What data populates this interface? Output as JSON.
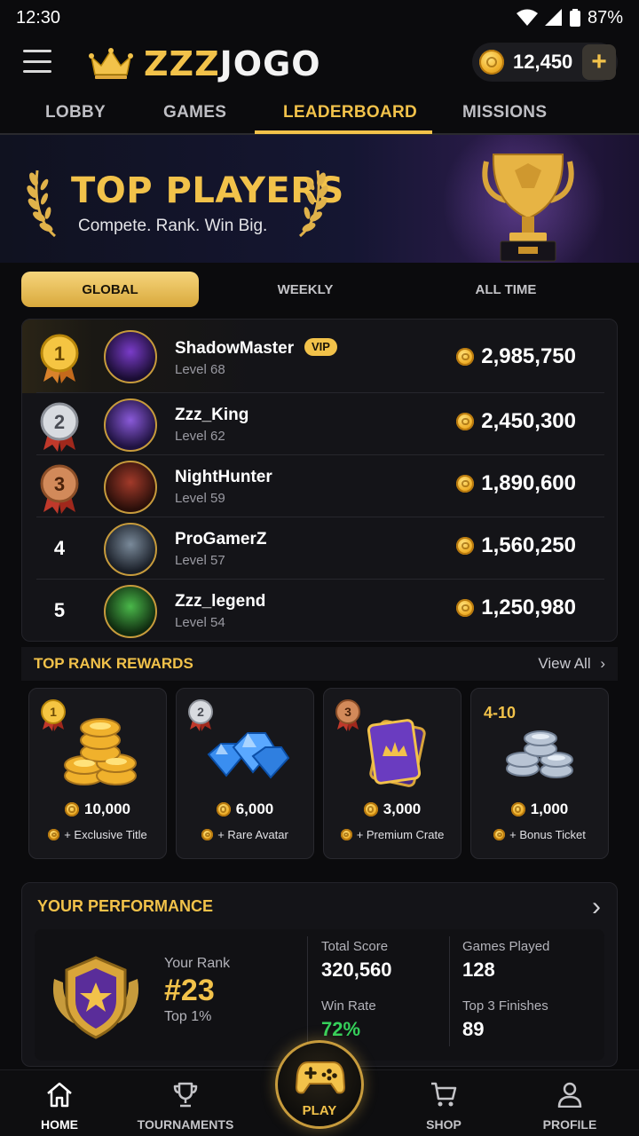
{
  "status_bar": {
    "time": "12:30",
    "battery": "87%"
  },
  "header": {
    "brand_first": "ZZZ",
    "brand_second": "JOGO",
    "coins": "12,450",
    "add_label": "+"
  },
  "tabs": [
    {
      "label": "LOBBY"
    },
    {
      "label": "GAMES"
    },
    {
      "label": "LEADERBOARD",
      "active": true
    },
    {
      "label": "MISSIONS"
    }
  ],
  "hero": {
    "title": "TOP PLAYERS",
    "subtitle": "Compete. Rank. Win Big."
  },
  "filters": [
    {
      "label": "GLOBAL",
      "active": true
    },
    {
      "label": "WEEKLY"
    },
    {
      "label": "ALL TIME"
    }
  ],
  "leaderboard": [
    {
      "rank": "1",
      "name": "ShadowMaster",
      "badge": "VIP",
      "level": "Level 68",
      "score": "2,985,750"
    },
    {
      "rank": "2",
      "name": "Zzz_King",
      "level": "Level 62",
      "score": "2,450,300"
    },
    {
      "rank": "3",
      "name": "NightHunter",
      "level": "Level 59",
      "score": "1,890,600"
    },
    {
      "rank": "4",
      "name": "ProGamerZ",
      "level": "Level 57",
      "score": "1,560,250"
    },
    {
      "rank": "5",
      "name": "Zzz_legend",
      "level": "Level 54",
      "score": "1,250,980"
    }
  ],
  "rewards": {
    "title": "TOP RANK REWARDS",
    "view_all": "View All",
    "items": [
      {
        "rank": "1",
        "amount": "10,000",
        "extra": "+ Exclusive Title"
      },
      {
        "rank": "2",
        "amount": "6,000",
        "extra": "+ Rare Avatar"
      },
      {
        "rank": "3",
        "amount": "3,000",
        "extra": "+ Premium Crate"
      },
      {
        "rank": "4-10",
        "amount": "1,000",
        "extra": "+ Bonus Ticket"
      }
    ]
  },
  "performance": {
    "title": "YOUR PERFORMANCE",
    "your_rank_label": "Your Rank",
    "your_rank": "#23",
    "top_percent": "Top 1%",
    "total_score_label": "Total Score",
    "total_score": "320,560",
    "games_played_label": "Games Played",
    "games_played": "128",
    "win_rate_label": "Win Rate",
    "win_rate": "72%",
    "top3_label": "Top 3 Finishes",
    "top3": "89"
  },
  "nav": {
    "home": "HOME",
    "tournaments": "TOURNAMENTS",
    "play": "PLAY",
    "shop": "SHOP",
    "profile": "PROFILE"
  },
  "colors": {
    "accent": "#f2c24a",
    "background": "#0b0b0d",
    "positive": "#35d05a"
  }
}
